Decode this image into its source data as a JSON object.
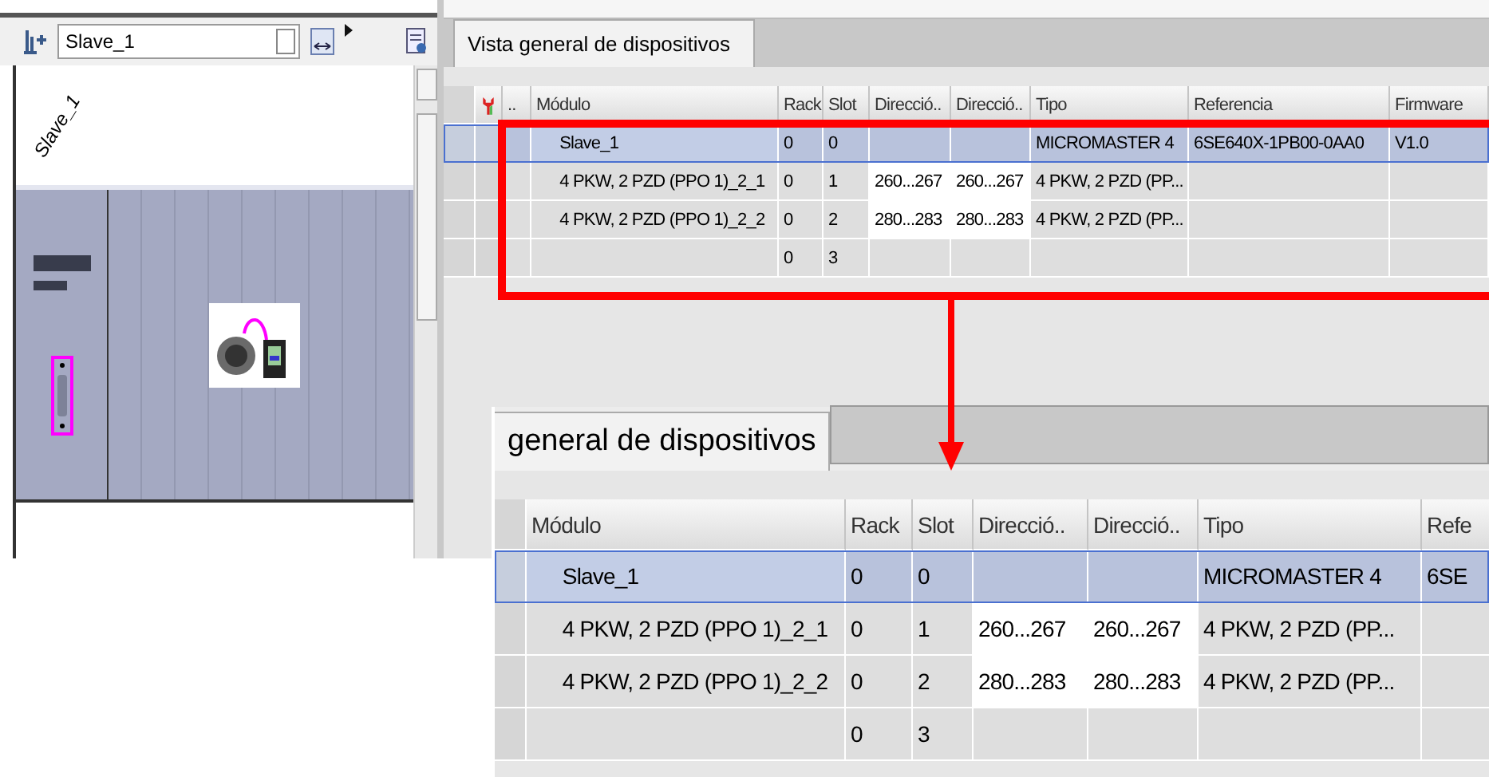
{
  "device_view": {
    "device_select": "Slave_1",
    "device_label": "Slave_1"
  },
  "overview": {
    "tab": "Vista general de dispositivos",
    "columns": [
      "..",
      "Módulo",
      "Rack",
      "Slot",
      "Direcció..",
      "Direcció..",
      "Tipo",
      "Referencia",
      "Firmware"
    ],
    "rows": [
      {
        "selected": true,
        "cells": [
          null,
          "Slave_1",
          "0",
          "0",
          null,
          null,
          "MICROMASTER 4",
          "6SE640X-1PB00-0AA0",
          "V1.0"
        ]
      },
      {
        "selected": false,
        "cells": [
          null,
          "4 PKW, 2 PZD (PPO 1)_2_1",
          "0",
          "1",
          "260...267",
          "260...267",
          "4 PKW, 2 PZD (PP...",
          null,
          null
        ]
      },
      {
        "selected": false,
        "cells": [
          null,
          "4 PKW, 2 PZD (PPO 1)_2_2",
          "0",
          "2",
          "280...283",
          "280...283",
          "4 PKW, 2 PZD (PP...",
          null,
          null
        ]
      },
      {
        "selected": false,
        "cells": [
          null,
          null,
          "0",
          "3",
          null,
          null,
          null,
          null,
          null
        ]
      }
    ]
  },
  "zoom_inset": {
    "tab": "general de dispositivos",
    "columns": [
      "Módulo",
      "Rack",
      "Slot",
      "Direcció..",
      "Direcció..",
      "Tipo",
      "Refe"
    ],
    "rows": [
      {
        "selected": true,
        "cells": [
          "Slave_1",
          "0",
          "0",
          null,
          null,
          "MICROMASTER 4",
          "6SE"
        ]
      },
      {
        "selected": false,
        "cells": [
          "4 PKW, 2 PZD (PPO 1)_2_1",
          "0",
          "1",
          "260...267",
          "260...267",
          "4 PKW, 2 PZD (PP...",
          null
        ]
      },
      {
        "selected": false,
        "cells": [
          "4 PKW, 2 PZD (PPO 1)_2_2",
          "0",
          "2",
          "280...283",
          "280...283",
          "4 PKW, 2 PZD (PP...",
          null
        ]
      },
      {
        "selected": false,
        "cells": [
          null,
          "0",
          "3",
          null,
          null,
          null,
          null
        ]
      }
    ]
  }
}
